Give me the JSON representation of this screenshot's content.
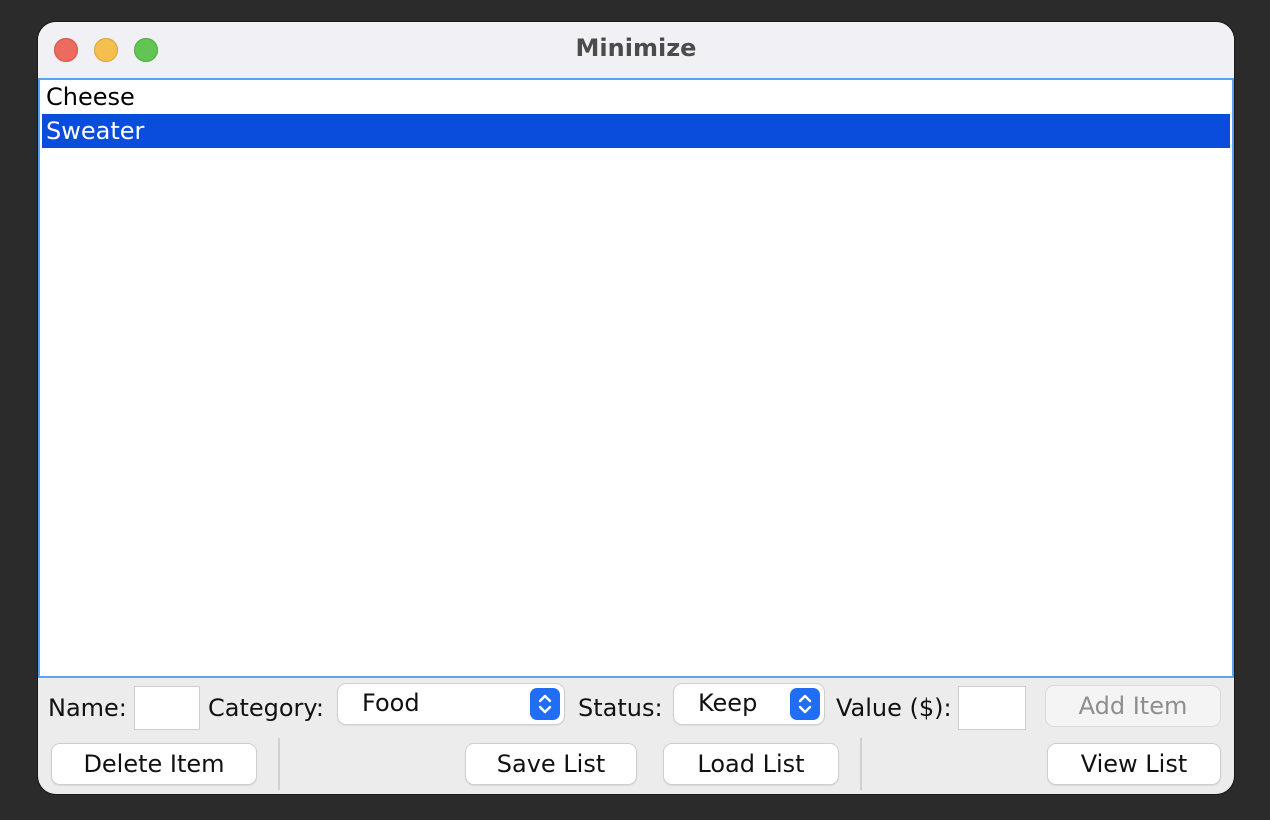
{
  "window": {
    "title": "Minimize"
  },
  "list": {
    "items": [
      {
        "label": "Cheese",
        "selected": false
      },
      {
        "label": "Sweater",
        "selected": true
      }
    ],
    "selection_color": "#0a4cdc"
  },
  "form": {
    "name_label": "Name:",
    "name_value": "",
    "category_label": "Category:",
    "category_value": "Food",
    "status_label": "Status:",
    "status_value": "Keep",
    "value_label": "Value ($):",
    "value_value": "",
    "add_item_label": "Add Item"
  },
  "actions": {
    "delete_label": "Delete Item",
    "save_label": "Save List",
    "load_label": "Load List",
    "view_label": "View List"
  },
  "colors": {
    "accent": "#1f6ef5",
    "focus_border": "#5aa2f2"
  }
}
